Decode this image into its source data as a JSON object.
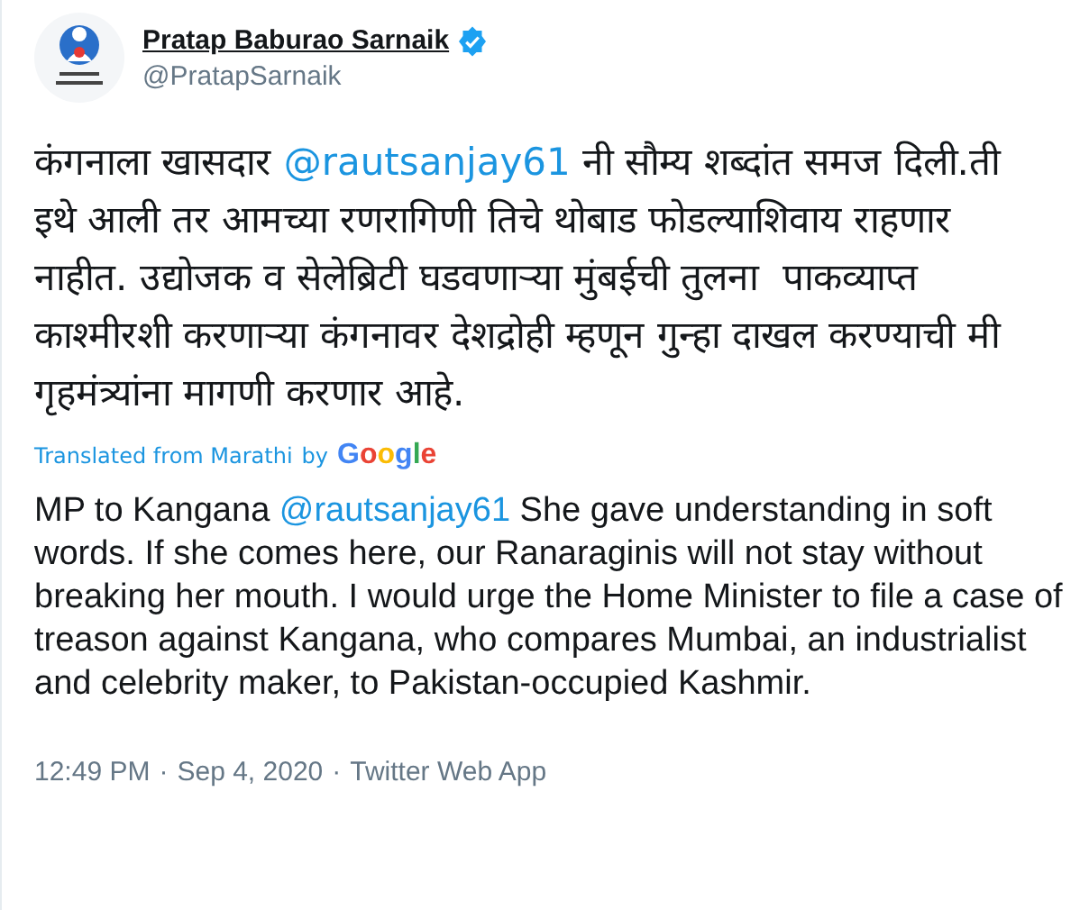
{
  "author": {
    "name": "Pratap Baburao Sarnaik",
    "handle": "@PratapSarnaik",
    "verified": true
  },
  "original_text": [
    {
      "kind": "text",
      "text": "कंगनाला खासदार "
    },
    {
      "kind": "mention",
      "text": "@rautsanjay61"
    },
    {
      "kind": "text",
      "text": " नी सौम्य शब्दांत समज दिली.ती इथे आली तर आमच्या रणरागिणी तिचे थोबाड फोडल्याशिवाय राहणार नाहीत. उद्योजक व सेलेब्रिटी घडवणाऱ्या मुंबईची तुलना  पाकव्याप्त काश्मीरशी करणाऱ्या कंगनावर देशद्रोही म्हणून गुन्हा दाखल करण्याची मी गृहमंत्र्यांना मागणी करणार आहे."
    }
  ],
  "translation_note": {
    "label": "Translated from Marathi",
    "by": "by",
    "provider": "Google"
  },
  "translated_text": [
    {
      "kind": "text",
      "text": "MP to Kangana "
    },
    {
      "kind": "mention",
      "text": "@rautsanjay61"
    },
    {
      "kind": "text",
      "text": " She gave understanding in soft words. If she comes here, our Ranaraginis will not stay without breaking her mouth. I would urge the Home Minister to file a case of treason against Kangana, who compares Mumbai, an industrialist and celebrity maker, to Pakistan-occupied Kashmir."
    }
  ],
  "footer": {
    "time": "12:49 PM",
    "sep1": "·",
    "date": "Sep 4, 2020",
    "sep2": "·",
    "source": "Twitter Web App"
  }
}
